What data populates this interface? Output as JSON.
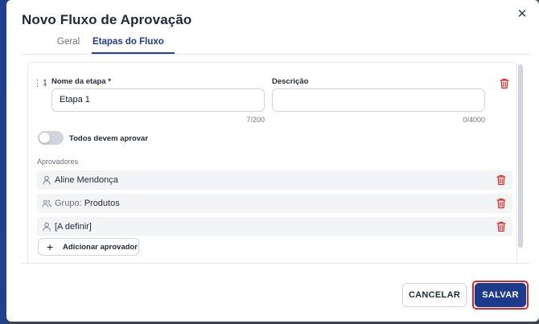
{
  "dialog": {
    "title": "Novo Fluxo de Aprovação",
    "close_glyph": "✕"
  },
  "tabs": [
    {
      "label": "Geral",
      "active": false
    },
    {
      "label": "Etapas do Fluxo",
      "active": true
    }
  ],
  "step": {
    "number": "1",
    "name_label": "Nome da etapa *",
    "name_value": "Etapa 1",
    "name_counter": "7/200",
    "description_label": "Descrição",
    "description_value": "",
    "description_counter": "0/4000",
    "all_must_approve_label": "Todos devem aprovar",
    "all_must_approve_on": false,
    "approvers_label": "Aprovadores",
    "approvers": [
      {
        "icon": "user-icon",
        "prefix": "",
        "name": "Aline Mendonça"
      },
      {
        "icon": "group-icon",
        "prefix": "Grupo: ",
        "name": "Produtos"
      },
      {
        "icon": "user-icon",
        "prefix": "",
        "name": "[A definir]"
      }
    ],
    "add_approver_label": "Adicionar aprovador"
  },
  "footer": {
    "cancel_label": "CANCELAR",
    "save_label": "SALVAR"
  },
  "colors": {
    "primary": "#1e3a8a",
    "danger": "#dc2626",
    "muted_bg": "#f3f4f6"
  }
}
